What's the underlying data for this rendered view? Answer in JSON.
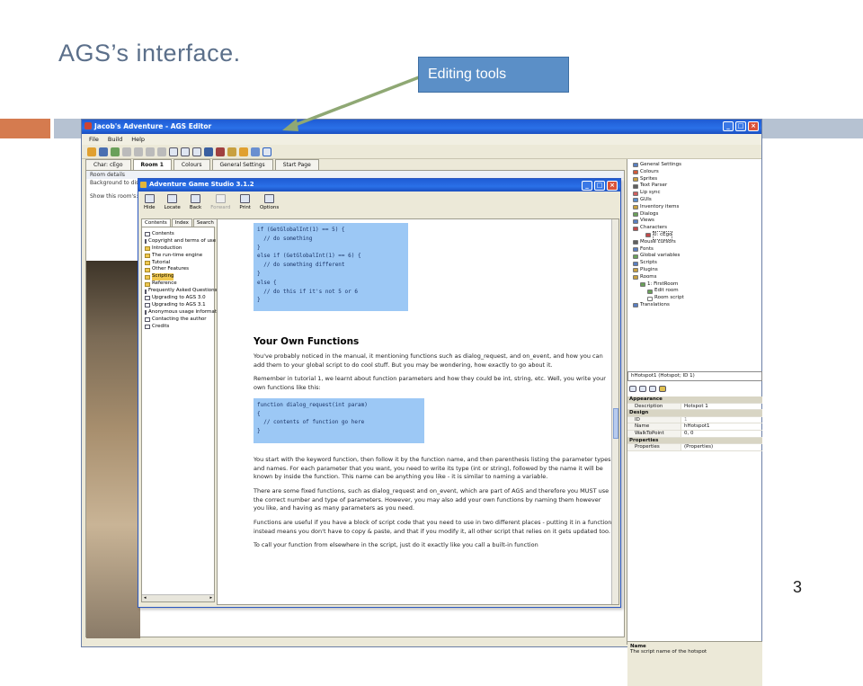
{
  "slide": {
    "title": "AGS’s interface.",
    "callout": "Editing tools",
    "page_number": "3"
  },
  "editor": {
    "title": "Jacob's Adventure - AGS Editor",
    "menu": [
      "File",
      "Build",
      "Help"
    ],
    "tabs": [
      "Char: cEgo",
      "Room 1",
      "Colours",
      "General Settings",
      "Start Page"
    ],
    "room_details": "Room details",
    "background_label": "Background to disp",
    "show_room_label": "Show this room's:",
    "tree": [
      {
        "label": "General Settings",
        "color": "#5a7fc0"
      },
      {
        "label": "Colours",
        "color": "#d05a3a"
      },
      {
        "label": "Sprites",
        "color": "#c8a040"
      },
      {
        "label": "Text Parser",
        "color": "#606060"
      },
      {
        "label": "Lip sync",
        "color": "#d06060"
      },
      {
        "label": "GUIs",
        "color": "#5a8fd0"
      },
      {
        "label": "Inventory items",
        "color": "#c8a040"
      },
      {
        "label": "Dialogs",
        "color": "#6aa05a"
      },
      {
        "label": "Views",
        "color": "#5a7fc0"
      },
      {
        "label": "Characters",
        "color": "#c04a4a"
      },
      {
        "label": "0: cEgo",
        "color": "#c04a4a"
      },
      {
        "label": "Mouse cursors",
        "color": "#606060"
      },
      {
        "label": "Fonts",
        "color": "#5a7fc0"
      },
      {
        "label": "Global variables",
        "color": "#6aa05a"
      },
      {
        "label": "Scripts",
        "color": "#5a7fc0"
      },
      {
        "label": "Plugins",
        "color": "#c8a040"
      },
      {
        "label": "Rooms",
        "color": "#c8a040"
      },
      {
        "label": "1: FirstRoom",
        "color": "#6aa05a"
      },
      {
        "label": "Edit room",
        "color": "#6aa05a"
      },
      {
        "label": "Room script",
        "color": "#ffffff"
      },
      {
        "label": "Translations",
        "color": "#5a7fc0"
      }
    ],
    "prop_select": "hHotspot1 (Hotspot; ID 1)",
    "properties": [
      {
        "k": "Appearance",
        "v": "",
        "cat": true
      },
      {
        "k": "Description",
        "v": "Hotspot 1",
        "cat": false
      },
      {
        "k": "Design",
        "v": "",
        "cat": true
      },
      {
        "k": "ID",
        "v": "1",
        "cat": false
      },
      {
        "k": "Name",
        "v": "hHotspot1",
        "cat": false
      },
      {
        "k": "WalkToPoint",
        "v": "0, 0",
        "cat": false
      },
      {
        "k": "Properties",
        "v": "",
        "cat": true
      },
      {
        "k": "Properties",
        "v": "(Properties)",
        "cat": false
      }
    ],
    "prop_desc_title": "Name",
    "prop_desc_text": "The script name of the hotspot"
  },
  "help": {
    "title": "Adventure Game Studio 3.1.2",
    "toolbar": [
      {
        "label": "Hide",
        "disabled": false
      },
      {
        "label": "Locate",
        "disabled": false
      },
      {
        "label": "Back",
        "disabled": false
      },
      {
        "label": "Forward",
        "disabled": true
      },
      {
        "label": "Print",
        "disabled": false
      },
      {
        "label": "Options",
        "disabled": false
      }
    ],
    "tabs": [
      "Contents",
      "Index",
      "Search"
    ],
    "toc": [
      {
        "label": "Contents",
        "icon": "page"
      },
      {
        "label": "Copyright and terms of use",
        "icon": "page"
      },
      {
        "label": "Introduction",
        "icon": "book"
      },
      {
        "label": "The run-time engine",
        "icon": "book"
      },
      {
        "label": "Tutorial",
        "icon": "book"
      },
      {
        "label": "Other Features",
        "icon": "book"
      },
      {
        "label": "Scripting",
        "icon": "book",
        "selected": true
      },
      {
        "label": "Reference",
        "icon": "book"
      },
      {
        "label": "Frequently Asked Questions",
        "icon": "page"
      },
      {
        "label": "Upgrading to AGS 3.0",
        "icon": "page"
      },
      {
        "label": "Upgrading to AGS 3.1",
        "icon": "page"
      },
      {
        "label": "Anonymous usage information",
        "icon": "page"
      },
      {
        "label": "Contacting the author",
        "icon": "page"
      },
      {
        "label": "Credits",
        "icon": "page"
      }
    ],
    "code1": "if (GetGlobalInt(1) == 5) {\n  // do something\n}\nelse if (GetGlobalInt(1) == 6) {\n  // do something different\n}\nelse {\n  // do this if it's not 5 or 6\n}",
    "heading": "Your Own Functions",
    "para1": "You've probably noticed in the manual, it mentioning functions such as dialog_request, and on_event, and how you can add them to your global script to do cool stuff. But you may be wondering, how exactly to go about it.",
    "para2": "Remember in tutorial 1, we learnt about function parameters and how they could be int, string, etc. Well, you write your own functions like this:",
    "code2": "function dialog_request(int param)\n{\n  // contents of function go here\n}",
    "para3": "You start with the keyword function, then follow it by the function name, and then parenthesis listing the parameter types and names. For each parameter that you want, you need to write its type (int or string), followed by the name it will be known by inside the function. This name can be anything you like - it is similar to naming a variable.",
    "para4": "There are some fixed functions, such as dialog_request and on_event, which are part of AGS and therefore you MUST use the correct number and type of parameters. However, you may also add your own functions by naming them however you like, and having as many parameters as you need.",
    "para5": "Functions are useful if you have a block of script code that you need to use in two different places - putting it in a function instead means you don't have to copy & paste, and that if you modify it, all other script that relies on it gets updated too.",
    "para6": "To call your function from elsewhere in the script, just do it exactly like you call a built-in function"
  }
}
